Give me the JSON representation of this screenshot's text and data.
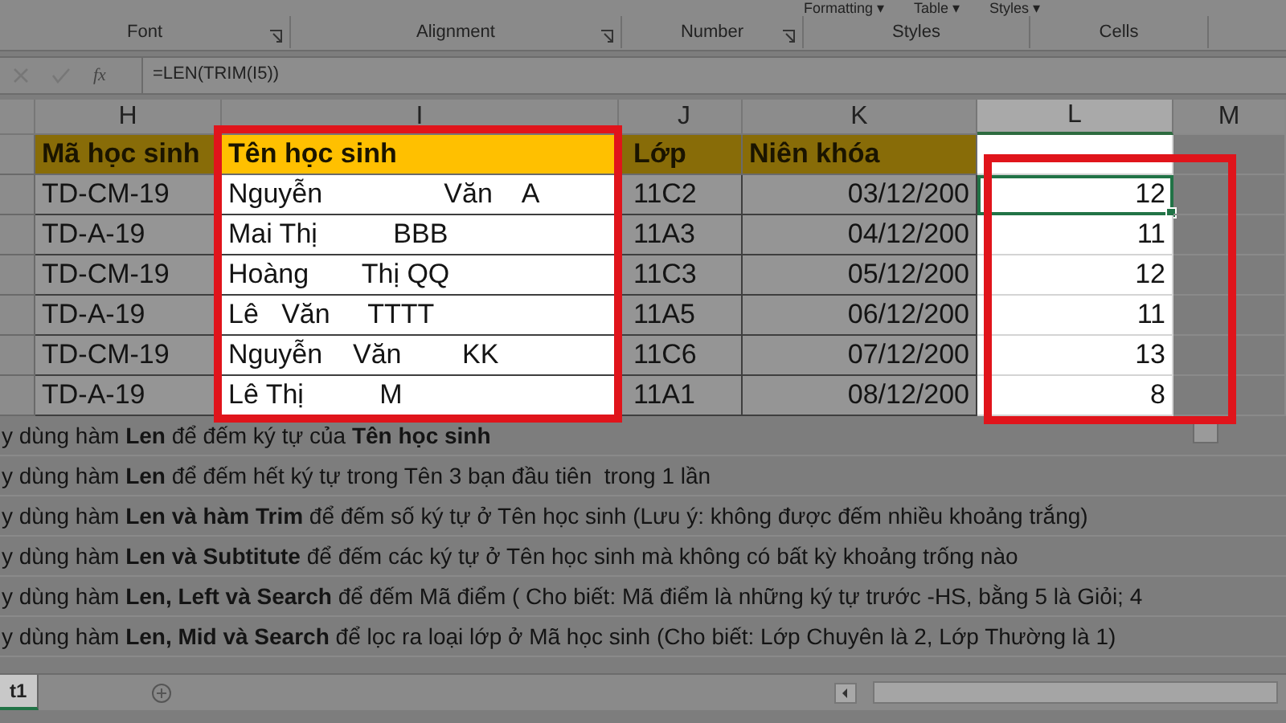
{
  "ribbon": {
    "top_items": [
      "Formatting ▾",
      "Table ▾",
      "Styles ▾"
    ],
    "groups": [
      "Font",
      "Alignment",
      "Number",
      "Styles",
      "Cells"
    ]
  },
  "formula_bar": {
    "fx_label": "fx",
    "formula": "=LEN(TRIM(I5))"
  },
  "columns": [
    {
      "label": "H",
      "selected": false
    },
    {
      "label": "I",
      "selected": false
    },
    {
      "label": "J",
      "selected": false
    },
    {
      "label": "K",
      "selected": false
    },
    {
      "label": "L",
      "selected": true
    },
    {
      "label": "M",
      "selected": false
    }
  ],
  "table": {
    "headers": [
      "Mã học sinh",
      "Tên học sinh",
      "Lớp",
      "Niên khóa"
    ],
    "rows": [
      {
        "ma": "TD-CM-19",
        "ten": "Nguyễn                Văn    A",
        "lop": "11C2",
        "nien_khoa": "03/12/200",
        "result": "12",
        "selected": true
      },
      {
        "ma": "TD-A-19",
        "ten": "Mai Thị          BBB",
        "lop": "11A3",
        "nien_khoa": "04/12/200",
        "result": "11",
        "selected": false
      },
      {
        "ma": "TD-CM-19",
        "ten": "Hoàng       Thị QQ",
        "lop": "11C3",
        "nien_khoa": "05/12/200",
        "result": "12",
        "selected": false
      },
      {
        "ma": "TD-A-19",
        "ten": "Lê   Văn     TTTT",
        "lop": "11A5",
        "nien_khoa": "06/12/200",
        "result": "11",
        "selected": false
      },
      {
        "ma": "TD-CM-19",
        "ten": "Nguyễn    Văn        KK",
        "lop": "11C6",
        "nien_khoa": "07/12/200",
        "result": "13",
        "selected": false
      },
      {
        "ma": "TD-A-19",
        "ten": "Lê Thị          M",
        "lop": "11A1",
        "nien_khoa": "08/12/200",
        "result": "8",
        "selected": false
      }
    ]
  },
  "instructions": [
    "y dùng hàm **Len** để đếm ký tự của **Tên học sinh**",
    "y dùng hàm **Len** để đếm hết ký tự trong Tên 3 bạn đầu tiên  trong 1 lần",
    "y dùng hàm **Len và hàm Trim** để đếm số ký tự ở Tên học sinh (Lưu ý: không được đếm nhiều khoảng trắng)",
    "y dùng hàm **Len và Subtitute** để đếm các ký tự ở Tên học sinh mà không có bất kỳ khoảng trống nào",
    "y dùng hàm **Len, Left và Search** để đếm Mã điểm ( Cho biết: Mã điểm là những ký tự trước -HS, bằng 5 là Giỏi; 4",
    "y dùng hàm **Len, Mid và Search** để lọc ra loại lớp ở Mã học sinh (Cho biết: Lớp Chuyên là 2, Lớp Thường là 1)"
  ],
  "sheet_tabs": [
    {
      "label": "t1",
      "selected": true
    }
  ]
}
